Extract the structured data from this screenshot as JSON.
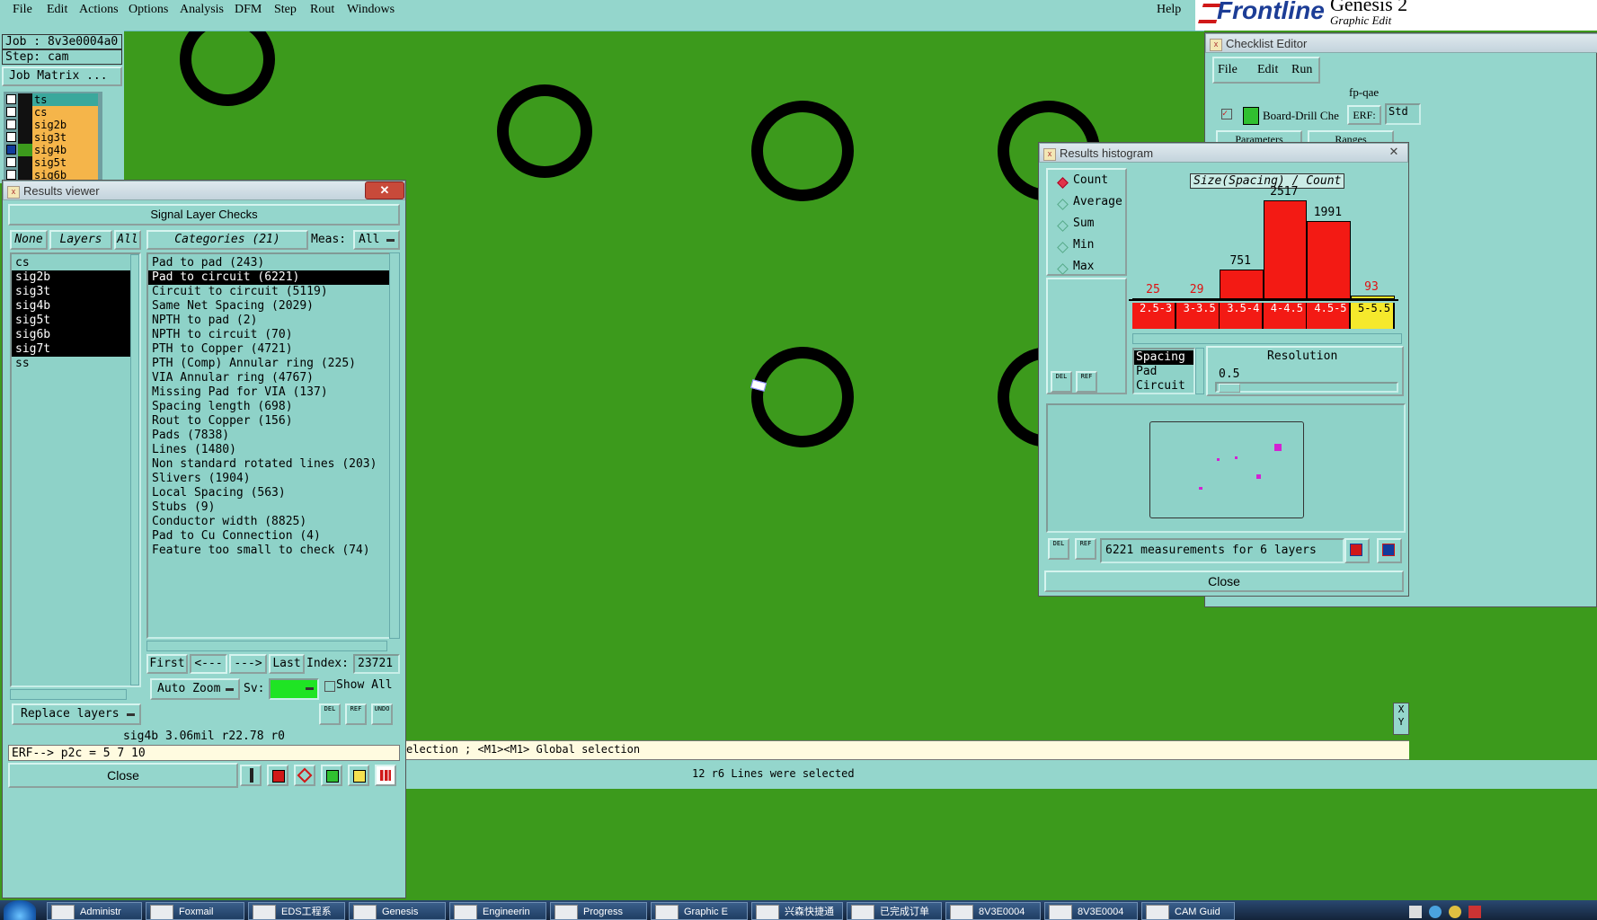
{
  "menubar": {
    "items": [
      "File",
      "Edit",
      "Actions",
      "Options",
      "Analysis",
      "DFM",
      "Step",
      "Rout",
      "Windows"
    ],
    "help": "Help"
  },
  "brand": {
    "logo": "Frontline",
    "product": "Genesis 2",
    "subtitle": "Graphic Edit"
  },
  "job": {
    "job_line": "Job : 8v3e0004a0",
    "step_line": "Step: cam",
    "matrix_button": "Job Matrix ...",
    "layers": [
      "ts",
      "cs",
      "sig2b",
      "sig3t",
      "sig4b",
      "sig5t",
      "sig6b"
    ]
  },
  "results_viewer": {
    "title": "Results viewer",
    "header": "Signal Layer Checks",
    "none_btn": "None",
    "layers_btn": "Layers",
    "all_btn": "All",
    "categories_btn": "Categories (21)",
    "meas_label": "Meas:",
    "meas_value": "All",
    "layers": [
      {
        "name": "cs",
        "selected": false
      },
      {
        "name": "sig2b",
        "selected": true
      },
      {
        "name": "sig3t",
        "selected": true
      },
      {
        "name": "sig4b",
        "selected": true
      },
      {
        "name": "sig5t",
        "selected": true
      },
      {
        "name": "sig6b",
        "selected": true
      },
      {
        "name": "sig7t",
        "selected": true
      },
      {
        "name": "ss",
        "selected": false
      }
    ],
    "categories": [
      {
        "label": "Pad to pad (243)",
        "selected": false
      },
      {
        "label": "Pad to circuit (6221)",
        "selected": true
      },
      {
        "label": "Circuit to circuit (5119)",
        "selected": false
      },
      {
        "label": "Same Net Spacing (2029)",
        "selected": false
      },
      {
        "label": "NPTH to pad (2)",
        "selected": false
      },
      {
        "label": "NPTH to circuit (70)",
        "selected": false
      },
      {
        "label": "PTH to Copper (4721)",
        "selected": false
      },
      {
        "label": "PTH (Comp) Annular ring (225)",
        "selected": false
      },
      {
        "label": "VIA Annular ring (4767)",
        "selected": false
      },
      {
        "label": "Missing Pad for VIA (137)",
        "selected": false
      },
      {
        "label": "Spacing length (698)",
        "selected": false
      },
      {
        "label": "Rout to Copper (156)",
        "selected": false
      },
      {
        "label": "Pads (7838)",
        "selected": false
      },
      {
        "label": "Lines (1480)",
        "selected": false
      },
      {
        "label": "Non standard rotated lines (203)",
        "selected": false
      },
      {
        "label": "Slivers (1904)",
        "selected": false
      },
      {
        "label": "Local Spacing (563)",
        "selected": false
      },
      {
        "label": "Stubs (9)",
        "selected": false
      },
      {
        "label": "Conductor width (8825)",
        "selected": false
      },
      {
        "label": "Pad to Cu Connection (4)",
        "selected": false
      },
      {
        "label": "Feature too small to check (74)",
        "selected": false
      }
    ],
    "first_btn": "First",
    "prev_btn": "<---",
    "next_btn": "--->",
    "last_btn": "Last",
    "index_label": "Index:",
    "index_value": "23721",
    "auto_zoom": "Auto Zoom",
    "sv_label": "Sv:",
    "show_all": "Show All",
    "replace_layers": "Replace layers",
    "status": "sig4b 3.06mil  r22.78  r0",
    "erf_line": "ERF--> p2c = 5 7 10",
    "close": "Close",
    "icons": {
      "del": "DEL",
      "ref": "REF",
      "undo": "UNDO"
    }
  },
  "checklist_editor": {
    "title": "Checklist Editor",
    "menu": [
      "File",
      "Edit",
      "Run"
    ],
    "name": "fp-qae",
    "action": "Board-Drill Che",
    "erf_label": "ERF:",
    "std": "Std",
    "tabs": [
      "Parameters",
      "Ranges"
    ]
  },
  "histogram": {
    "title": "Results histogram",
    "modes": [
      {
        "label": "Count",
        "on": true
      },
      {
        "label": "Average",
        "on": false
      },
      {
        "label": "Sum",
        "on": false
      },
      {
        "label": "Min",
        "on": false
      },
      {
        "label": "Max",
        "on": false
      }
    ],
    "chart_title": "Size(Spacing) / Count",
    "ranges": [
      "2.5-3",
      "3-3.5",
      "3.5-4",
      "4-4.5",
      "4.5-5",
      "5-5.5"
    ],
    "counts": [
      25,
      29,
      751,
      2517,
      1991,
      93
    ],
    "bar_colors": [
      "#f31a14",
      "#f31a14",
      "#f31a14",
      "#f31a14",
      "#f31a14",
      "#f5e92c"
    ],
    "types": [
      "Spacing",
      "Pad",
      "Circuit"
    ],
    "resolution_label": "Resolution",
    "resolution_value": "0.5",
    "summary": "6221 measurements for 6 layers",
    "close": "Close",
    "icons": {
      "del": "DEL",
      "ref": "REF"
    }
  },
  "statusbar": {
    "hint": "election ; <M1><M1> Global selection",
    "selection": "12 r6 Lines were selected"
  },
  "xy_label": "X Y",
  "taskbar": [
    "Administr",
    "Foxmail",
    "EDS工程系",
    "Genesis",
    "Engineerin",
    "Progress",
    "Graphic E",
    "兴森快捷通",
    "已完成订单",
    "8V3E0004",
    "8V3E0004",
    "CAM Guid"
  ]
}
